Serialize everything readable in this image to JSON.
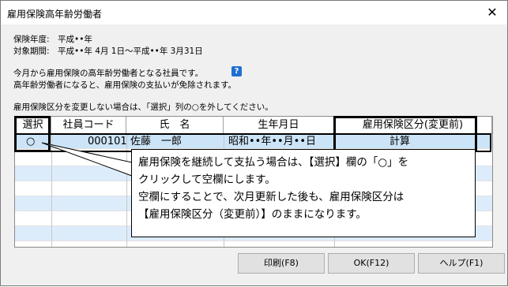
{
  "window": {
    "title": "雇用保険高年齢労働者",
    "close_symbol": "✕"
  },
  "info": {
    "fiscal_year": "保険年度:　平成••年",
    "period": "対象期間:　平成••年 4月 1日～平成••年 3月31日",
    "line1": "今月から雇用保険の高年齢労働者となる社員です。",
    "help_symbol": "?",
    "line2": "高年齢労働者になると、雇用保険の支払いが免除されます。",
    "instruction": "雇用保険区分を変更しない場合は、「選択」列の○を外してください。"
  },
  "table": {
    "columns": [
      "選択",
      "社員コード",
      "氏　名",
      "生年月日",
      "雇用保険区分(変更前)"
    ],
    "rows": [
      {
        "select": "○",
        "code": "000101",
        "name": "佐藤　一郎",
        "birth": "昭和••年••月••日",
        "kubun": "計算"
      }
    ]
  },
  "callout": {
    "line1": "雇用保険を継続して支払う場合は、【選択】欄の「○」を",
    "line2": "クリックして空欄にします。",
    "line3": "空欄にすることで、次月更新した後も、雇用保険区分は",
    "line4": "【雇用保険区分（変更前）】のままになります。"
  },
  "buttons": {
    "print": "印刷(F8)",
    "ok": "OK(F12)",
    "help": "ヘルプ(F1)"
  }
}
